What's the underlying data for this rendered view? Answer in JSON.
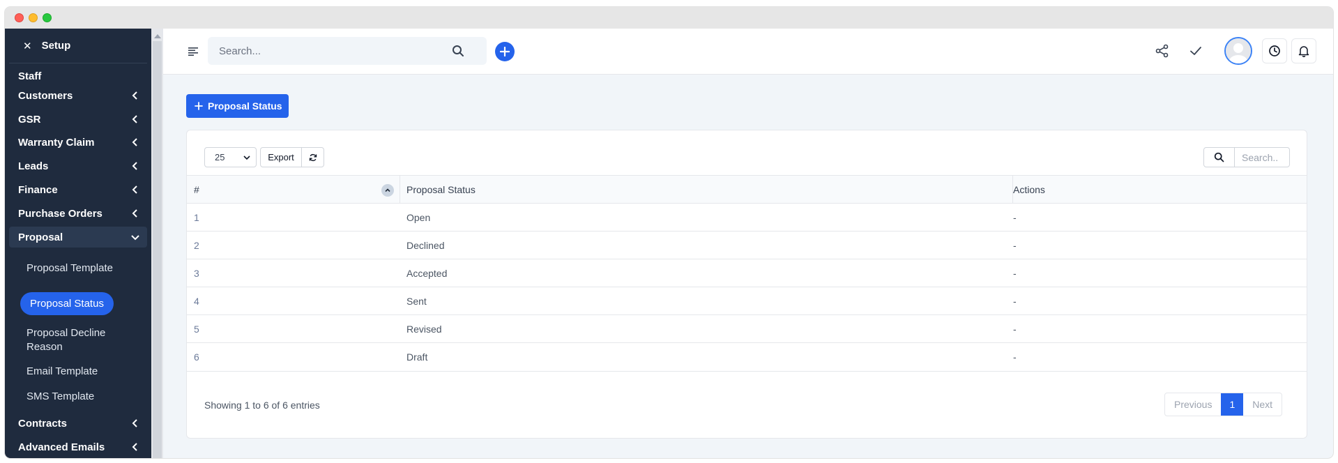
{
  "sidebar": {
    "title": "Setup",
    "close_glyph": "✕",
    "items": [
      {
        "label": "Staff",
        "has_chevron": false
      },
      {
        "label": "Customers",
        "has_chevron": true
      },
      {
        "label": "GSR",
        "has_chevron": true
      },
      {
        "label": "Warranty Claim",
        "has_chevron": true
      },
      {
        "label": "Leads",
        "has_chevron": true
      },
      {
        "label": "Finance",
        "has_chevron": true
      },
      {
        "label": "Purchase Orders",
        "has_chevron": true
      },
      {
        "label": "Proposal",
        "has_chevron": true,
        "expanded": true
      },
      {
        "label": "Contracts",
        "has_chevron": true
      },
      {
        "label": "Advanced Emails",
        "has_chevron": true
      }
    ],
    "proposal_sub": [
      {
        "label": "Proposal Template"
      },
      {
        "label": "Proposal Status",
        "active": true
      },
      {
        "label": "Proposal Decline Reason"
      },
      {
        "label": "Email Template"
      },
      {
        "label": "SMS Template"
      }
    ]
  },
  "topbar": {
    "search_placeholder": "Search...",
    "icons": [
      "hamburger-icon",
      "search-icon",
      "plus-icon",
      "share-icon",
      "check-icon",
      "avatar",
      "clock-icon",
      "bell-icon"
    ]
  },
  "page": {
    "add_button_label": "Proposal Status"
  },
  "table": {
    "page_length": "25",
    "export_label": "Export",
    "search_placeholder": "Search..",
    "columns": [
      "#",
      "Proposal Status",
      "Actions"
    ],
    "rows": [
      {
        "id": "1",
        "status": "Open",
        "actions": "-"
      },
      {
        "id": "2",
        "status": "Declined",
        "actions": "-"
      },
      {
        "id": "3",
        "status": "Accepted",
        "actions": "-"
      },
      {
        "id": "4",
        "status": "Sent",
        "actions": "-"
      },
      {
        "id": "5",
        "status": "Revised",
        "actions": "-"
      },
      {
        "id": "6",
        "status": "Draft",
        "actions": "-"
      }
    ],
    "info": "Showing 1 to 6 of 6 entries",
    "pagination": {
      "previous": "Previous",
      "current": "1",
      "next": "Next"
    }
  },
  "colors": {
    "sidebar_bg": "#1f2b3e",
    "accent": "#2563eb",
    "page_bg": "#f1f5f9"
  }
}
